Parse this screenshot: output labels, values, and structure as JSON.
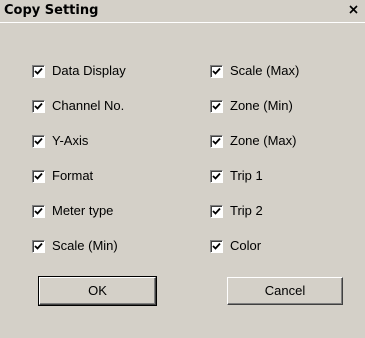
{
  "dialog": {
    "title": "Copy Setting"
  },
  "left_column": [
    {
      "label": "Data Display",
      "checked": true
    },
    {
      "label": "Channel No.",
      "checked": true
    },
    {
      "label": "Y-Axis",
      "checked": true
    },
    {
      "label": "Format",
      "checked": true
    },
    {
      "label": "Meter type",
      "checked": true
    },
    {
      "label": "Scale (Min)",
      "checked": true
    }
  ],
  "right_column": [
    {
      "label": "Scale (Max)",
      "checked": true
    },
    {
      "label": "Zone (Min)",
      "checked": true
    },
    {
      "label": "Zone (Max)",
      "checked": true
    },
    {
      "label": "Trip 1",
      "checked": true
    },
    {
      "label": "Trip 2",
      "checked": true
    },
    {
      "label": "Color",
      "checked": true
    }
  ],
  "buttons": {
    "ok_label": "OK",
    "cancel_label": "Cancel"
  },
  "icons": {
    "close": "close-icon",
    "checkmark": "checkmark-icon"
  }
}
